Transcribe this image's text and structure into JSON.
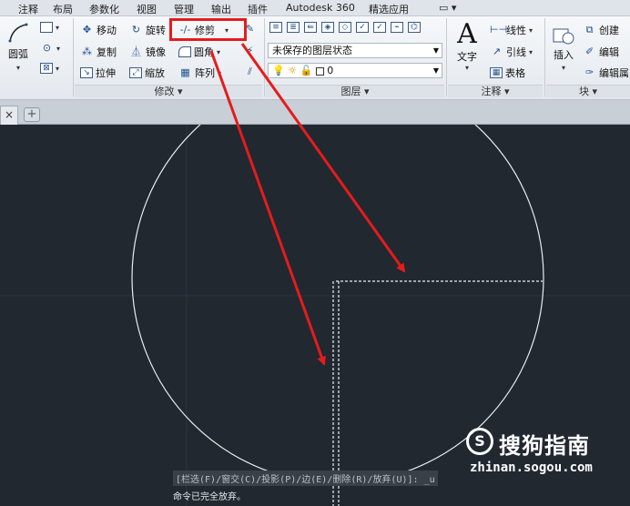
{
  "menu_tabs": [
    "注释",
    "布局",
    "参数化",
    "视图",
    "管理",
    "输出",
    "插件",
    "Autodesk 360",
    "精选应用"
  ],
  "menu_extra": "▭ ▾",
  "draw_panel": {
    "arc_label": "圆弧",
    "arc_caret": "▾"
  },
  "modify_panel": {
    "title": "修改 ▾",
    "move": "移动",
    "rotate": "旋转",
    "trim": "修剪",
    "copy": "复制",
    "mirror": "镜像",
    "fillet": "圆角",
    "stretch": "拉伸",
    "scale": "缩放",
    "array": "阵列"
  },
  "layers_panel": {
    "title": "图层 ▾",
    "layer_state": "未保存的图层状态",
    "current_layer": "0"
  },
  "annotation_panel": {
    "title": "注释 ▾",
    "text": "文字",
    "linear": "线性",
    "leader": "引线",
    "table": "表格"
  },
  "block_panel": {
    "title": "块 ▾",
    "insert": "插入",
    "create": "创建",
    "edit": "编辑",
    "edit_attr": "编辑属"
  },
  "doc_tab_close": "×",
  "new_tab": "+",
  "command_line": {
    "prompt": "[栏选(F)/窗交(C)/投影(P)/边(E)/删除(R)/放弃(U)]: _u",
    "message": "命令已完全放弃。"
  },
  "watermark": {
    "logo": "S",
    "name": "搜狗指南",
    "url": "zhinan.sogou.com"
  },
  "colors": {
    "annotation_red": "#e41c1c",
    "canvas_bg": "#212830"
  }
}
